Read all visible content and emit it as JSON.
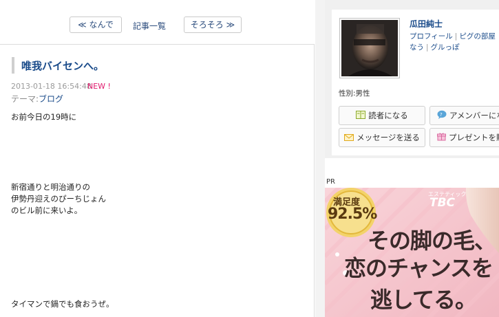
{
  "nav": {
    "prev_label": "≪ なんで",
    "list_label": "記事一覧",
    "next_label": "そろそろ ≫"
  },
  "article": {
    "title": "唯我バイセンへ。",
    "date": "2013-01-18 16:54:48",
    "new_badge": "NEW !",
    "theme_prefix": "テーマ:",
    "theme": "ブログ",
    "lines": [
      "お前今日の19時に",
      "新宿通りと明治通りの",
      "伊勢丹迎えのぴーちじょん",
      "のビル前に来いよ。",
      "タイマンで鍋でも食おうぜ。"
    ]
  },
  "profile": {
    "name": "瓜田純士",
    "link_profile": "プロフィール",
    "link_room": "ピグの部屋",
    "link_now": "なう",
    "link_gurupe": "グルっぽ",
    "gender": "性別:男性",
    "btn_reader": "読者になる",
    "btn_amember": "アメンバーにな",
    "btn_message": "メッセージを送る",
    "btn_present": "プレゼントを贈"
  },
  "pr": {
    "label": "PR",
    "badge_top": "満足度",
    "badge_value": "92.5%",
    "brand_small": "エステティック",
    "brand": "TBC",
    "line1": "その脚の毛、",
    "line2": "恋のチャンスを",
    "line3": "逃してる。"
  },
  "colors": {
    "link": "#1a4b8a",
    "new_badge": "#e0186c",
    "ad_pink": "#f6c9cf"
  },
  "icons": {
    "reader": "book-icon",
    "amember": "chat-bubble-icon",
    "message": "envelope-icon",
    "present": "gift-icon"
  }
}
